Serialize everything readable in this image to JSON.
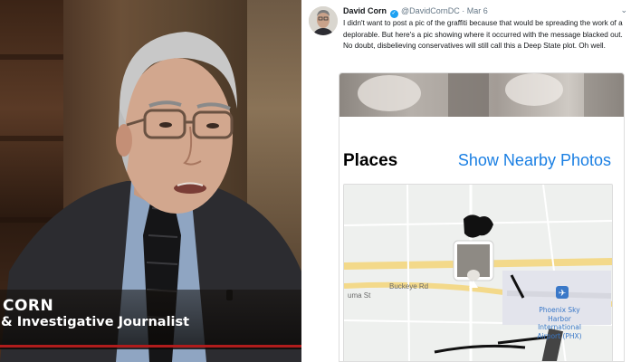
{
  "tv": {
    "name_line": "CORN",
    "role_line": "& Investigative Journalist"
  },
  "tweet": {
    "author_name": "David Corn",
    "handle": "@DavidCornDC",
    "separator": "·",
    "date": "Mar 6",
    "text": "I didn't want to post a pic of the graffiti because that would be spreading the work of a deplorable. But here's a pic showing where it occurred with the message blacked out. No doubt, disbelieving conservatives will still call this a Deep State plot. Oh well.",
    "caret_icon": "chevron-down-icon",
    "verified_icon": "verified-badge-icon"
  },
  "screenshot": {
    "section_title": "Places",
    "nearby_link": "Show Nearby Photos",
    "map_labels": {
      "street_1": "uma St",
      "street_2": "Buckeye Rd",
      "airport_line_1": "Phoenix Sky",
      "airport_line_2": "Harbor",
      "airport_line_3": "International",
      "airport_line_4": "Airport (PHX)"
    }
  },
  "colors": {
    "accent_blue": "#1a7fe3",
    "twitter_blue": "#1da1f2",
    "lower_third_red": "#b01c1c",
    "map_road_yellow": "#f3d98a"
  }
}
